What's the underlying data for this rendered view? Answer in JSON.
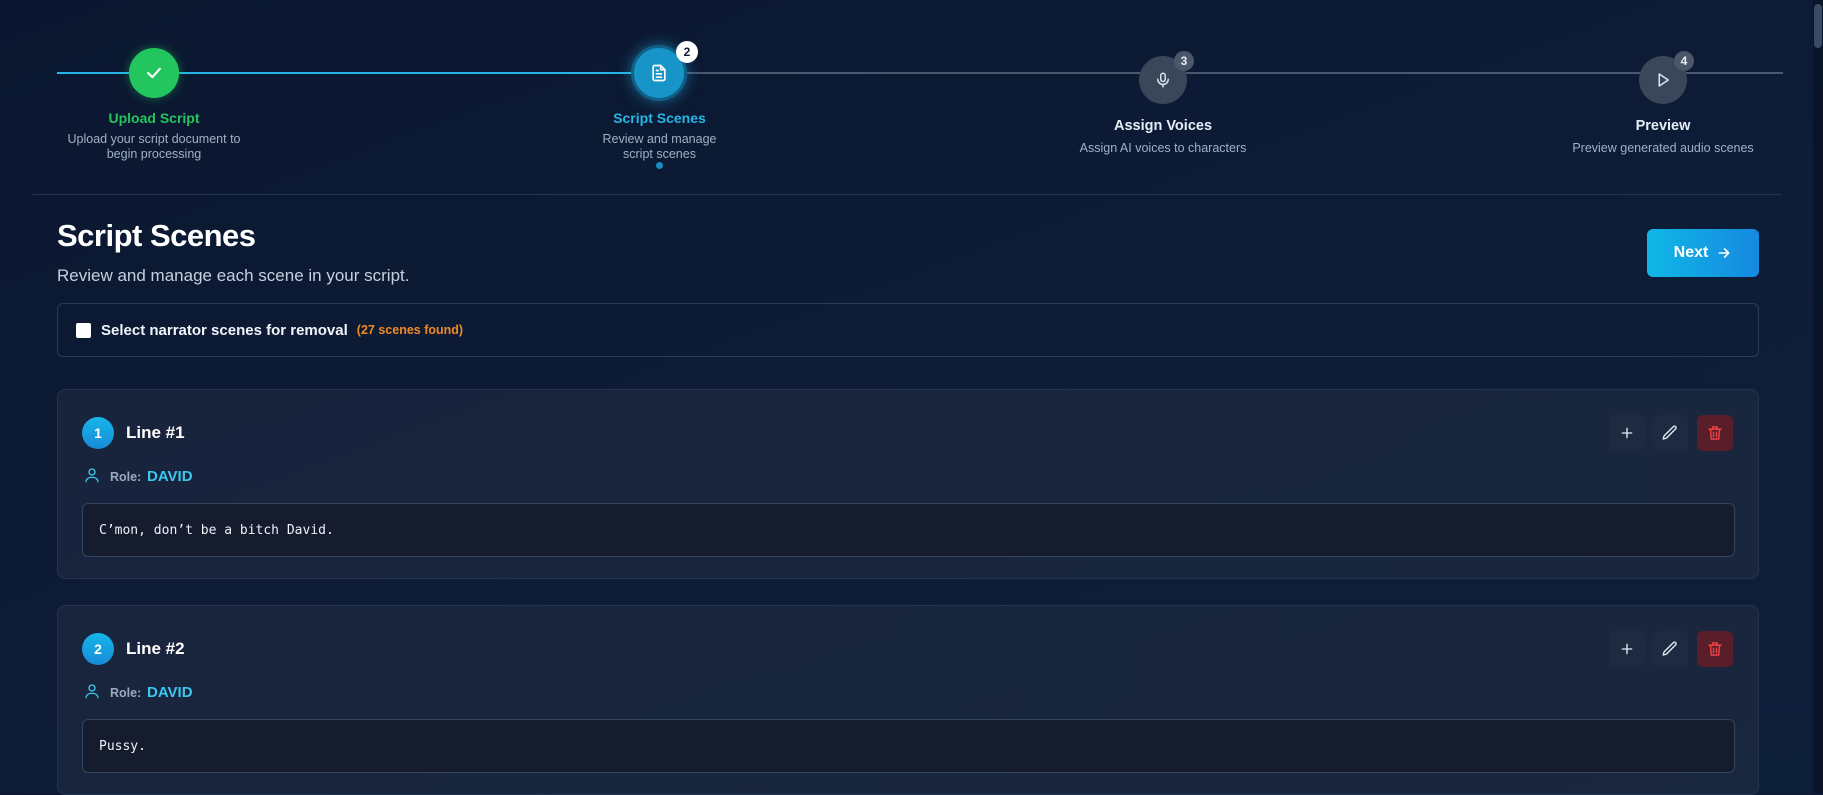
{
  "stepper": {
    "steps": [
      {
        "title": "Upload Script",
        "description": "Upload your script document to begin processing",
        "status": "completed",
        "icon": "check-icon"
      },
      {
        "title": "Script Scenes",
        "description": "Review and manage script scenes",
        "status": "active",
        "badge": "2",
        "icon": "document-icon"
      },
      {
        "title": "Assign Voices",
        "description": "Assign AI voices to characters",
        "status": "pending",
        "badge": "3",
        "icon": "microphone-icon"
      },
      {
        "title": "Preview",
        "description": "Preview generated audio scenes",
        "status": "pending",
        "badge": "4",
        "icon": "play-icon"
      }
    ]
  },
  "header": {
    "title": "Script Scenes",
    "subtitle": "Review and manage each scene in your script.",
    "next_label": "Next"
  },
  "narrator": {
    "label": "Select narrator scenes for removal",
    "count": "(27 scenes found)"
  },
  "scenes": [
    {
      "number": "1",
      "title": "Line #1",
      "role_label": "Role:",
      "role": "DAVID",
      "text": "C’mon, don’t be a bitch David."
    },
    {
      "number": "2",
      "title": "Line #2",
      "role_label": "Role:",
      "role": "DAVID",
      "text": "Pussy."
    }
  ],
  "colors": {
    "accent": "#25b6e6",
    "success": "#22c55e",
    "warning": "#f08a24",
    "danger": "#ef4444"
  }
}
